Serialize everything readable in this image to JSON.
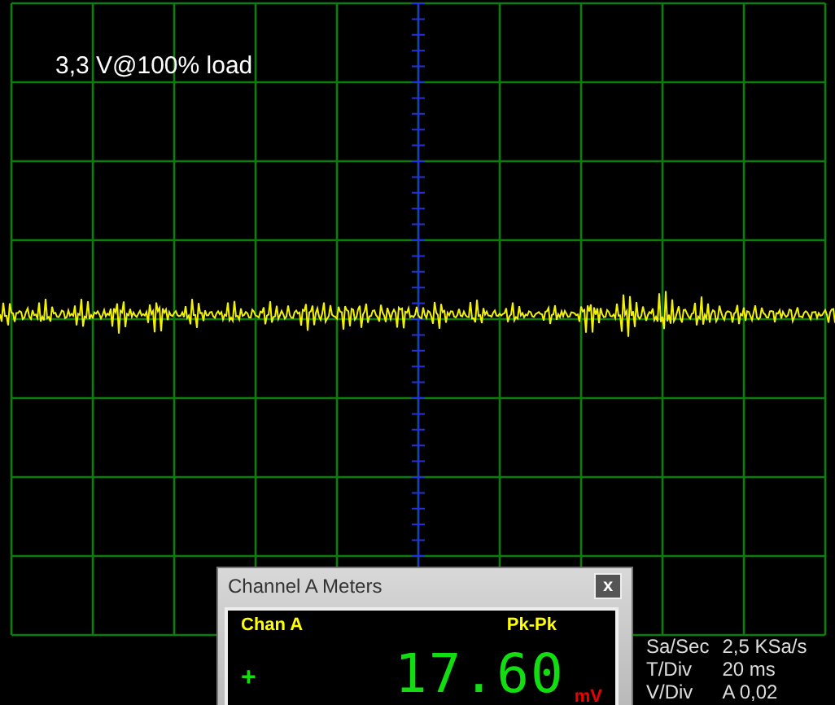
{
  "trace_label": "3,3 V@100% load",
  "meter_window": {
    "title": "Channel A Meters",
    "close": "x",
    "channel": "Chan A",
    "measurement": "Pk-Pk",
    "polarity": "+",
    "value": "17.60",
    "unit": "mV"
  },
  "settings": [
    {
      "label": "Sa/Sec",
      "value": "2,5 KSa/s"
    },
    {
      "label": "T/Div",
      "value": "20 ms"
    },
    {
      "label": "V/Div",
      "value": "A 0,02"
    }
  ]
}
